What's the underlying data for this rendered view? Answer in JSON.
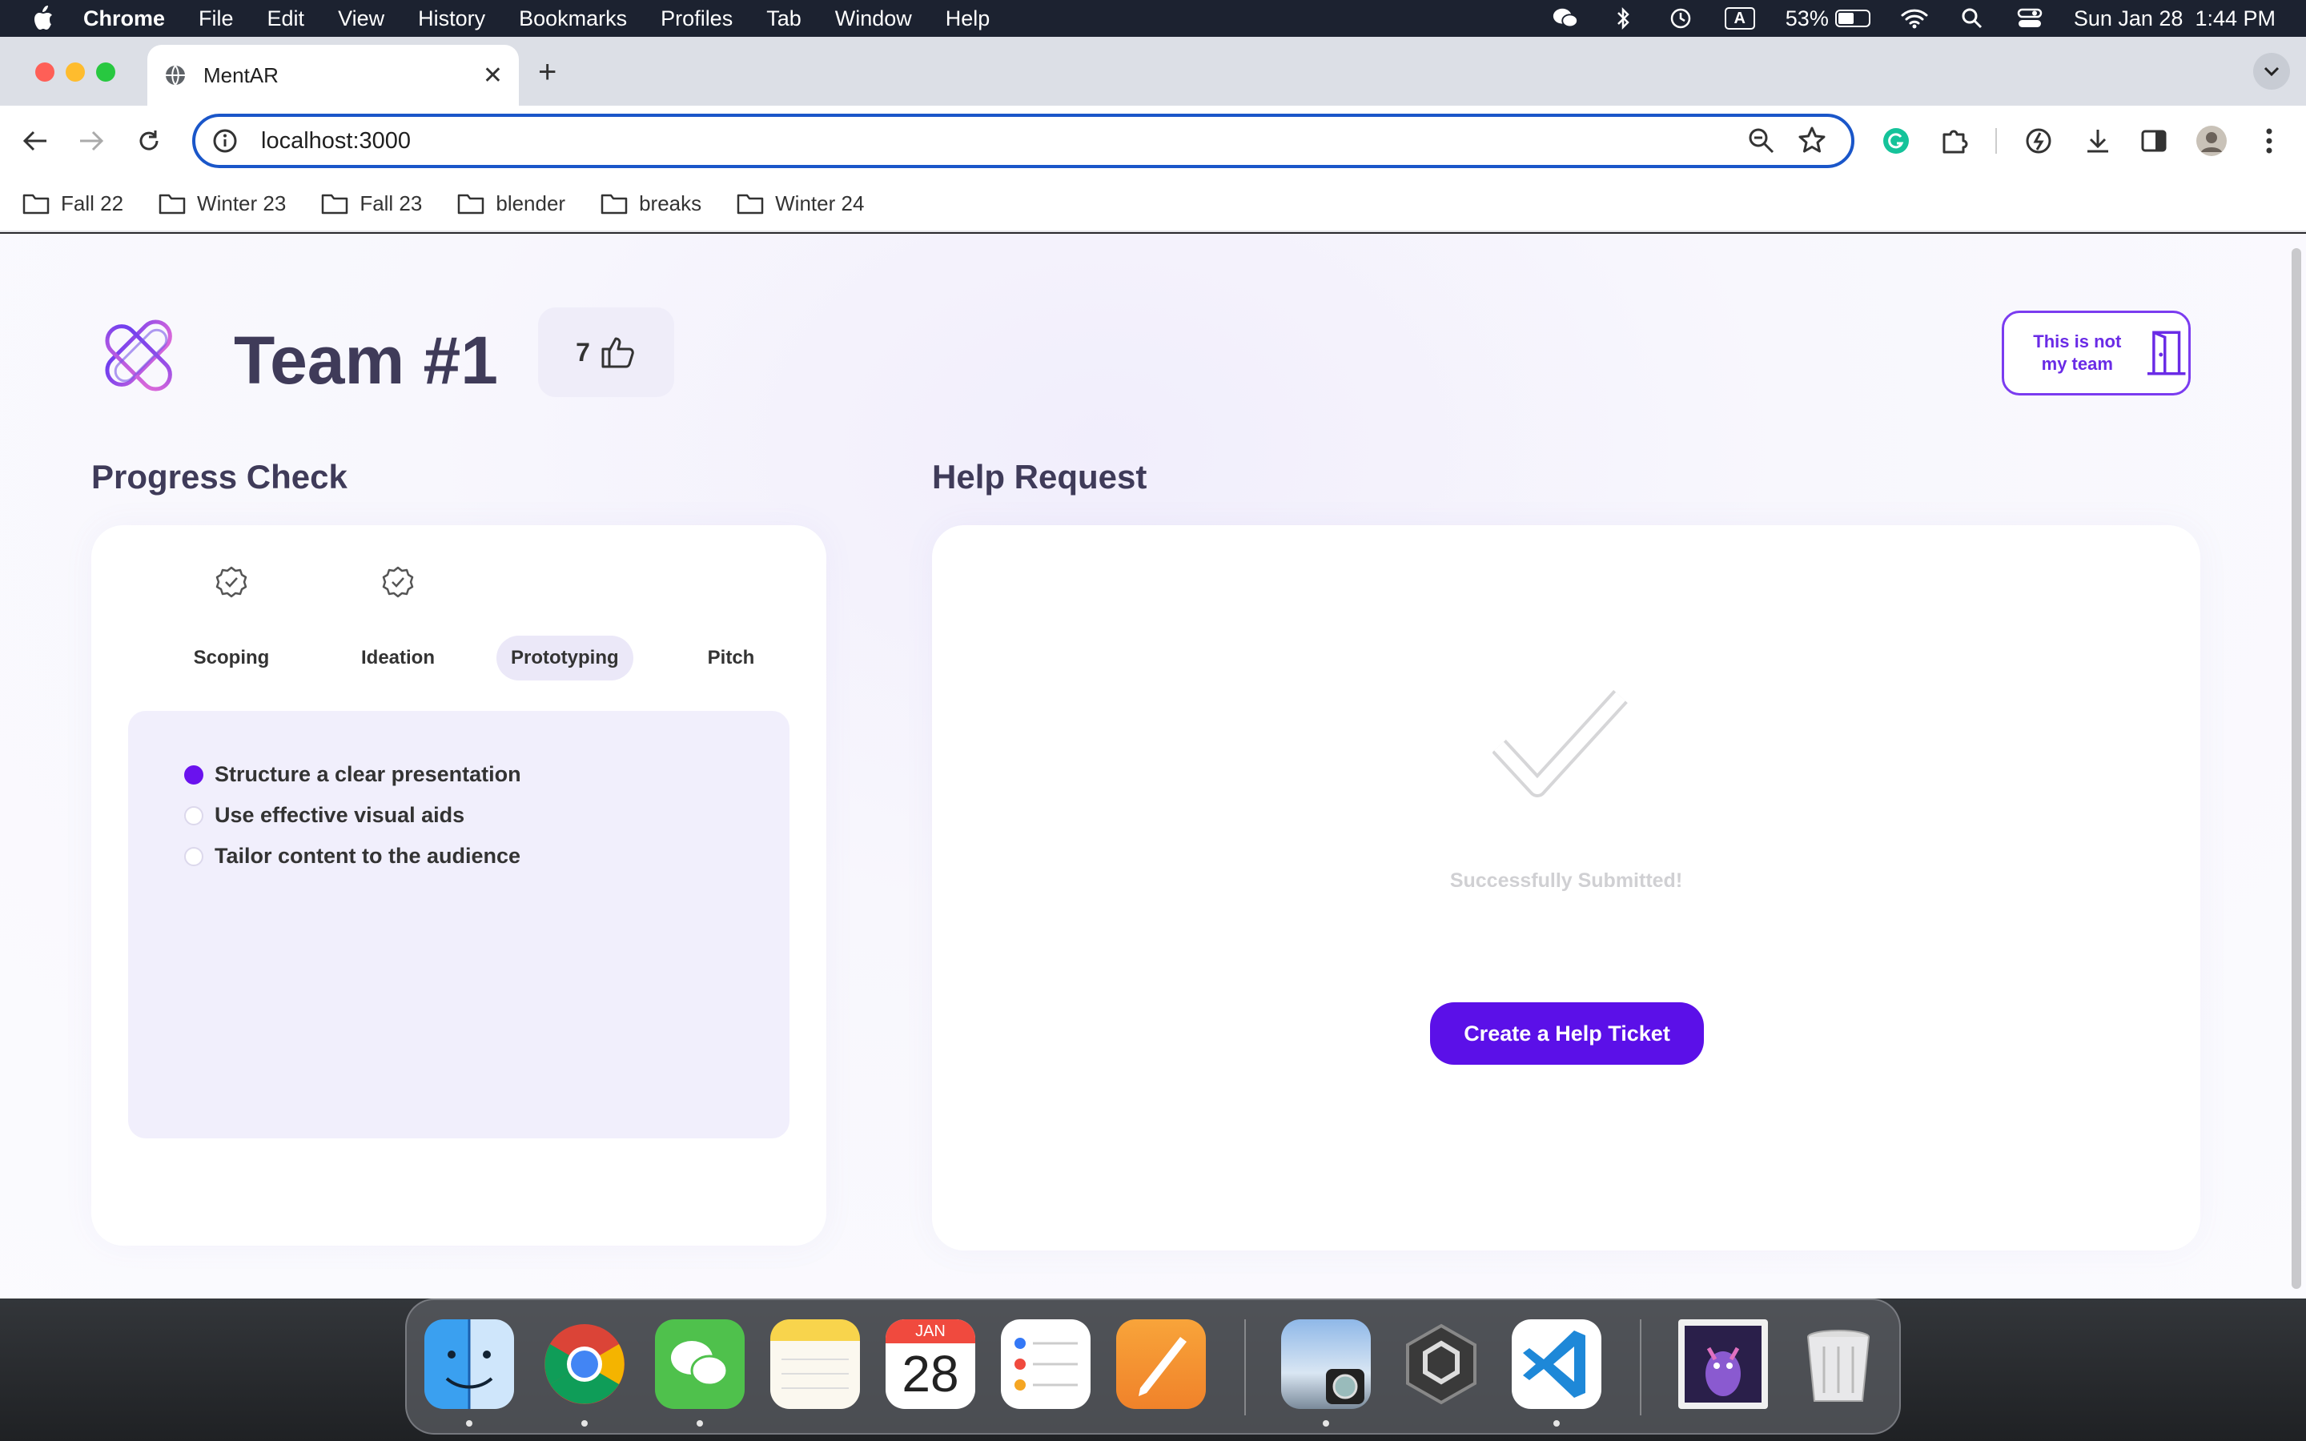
{
  "menubar": {
    "app": "Chrome",
    "menus": [
      "File",
      "Edit",
      "View",
      "History",
      "Bookmarks",
      "Profiles",
      "Tab",
      "Window",
      "Help"
    ],
    "battery": "53%",
    "battery_level": 0.53,
    "keyboard": "A",
    "datetime": "Sun Jan 28  1:44 PM"
  },
  "browser": {
    "tab_title": "MentAR",
    "url": "localhost:3000",
    "bookmarks": [
      "Fall 22",
      "Winter 23",
      "Fall 23",
      "blender",
      "breaks",
      "Winter 24"
    ]
  },
  "header": {
    "team_title": "Team #1",
    "likes": "7",
    "not_team_label": "This is not my team"
  },
  "progress": {
    "title": "Progress Check",
    "steps": [
      {
        "label": "Scoping",
        "done": true
      },
      {
        "label": "Ideation",
        "done": true
      },
      {
        "label": "Prototyping",
        "active": true
      },
      {
        "label": "Pitch"
      }
    ],
    "tasks": [
      {
        "label": "Structure a clear presentation",
        "checked": true
      },
      {
        "label": "Use effective visual aids",
        "checked": false
      },
      {
        "label": "Tailor content to the audience",
        "checked": false
      }
    ]
  },
  "help": {
    "title": "Help Request",
    "status": "Successfully Submitted!",
    "button": "Create a Help Ticket"
  },
  "dock": {
    "calendar_month": "JAN",
    "calendar_day": "28",
    "apps": [
      "finder-icon",
      "chrome-icon",
      "wechat-icon",
      "notes-icon",
      "calendar-icon",
      "reminders-icon",
      "pages-icon",
      "preview-icon",
      "unity-icon",
      "vscode-icon",
      "image-thumbnail",
      "trash-icon"
    ]
  },
  "colors": {
    "accent": "#5b10e8",
    "title_text": "#3f3b59",
    "panel_bg": "#f1effc"
  }
}
